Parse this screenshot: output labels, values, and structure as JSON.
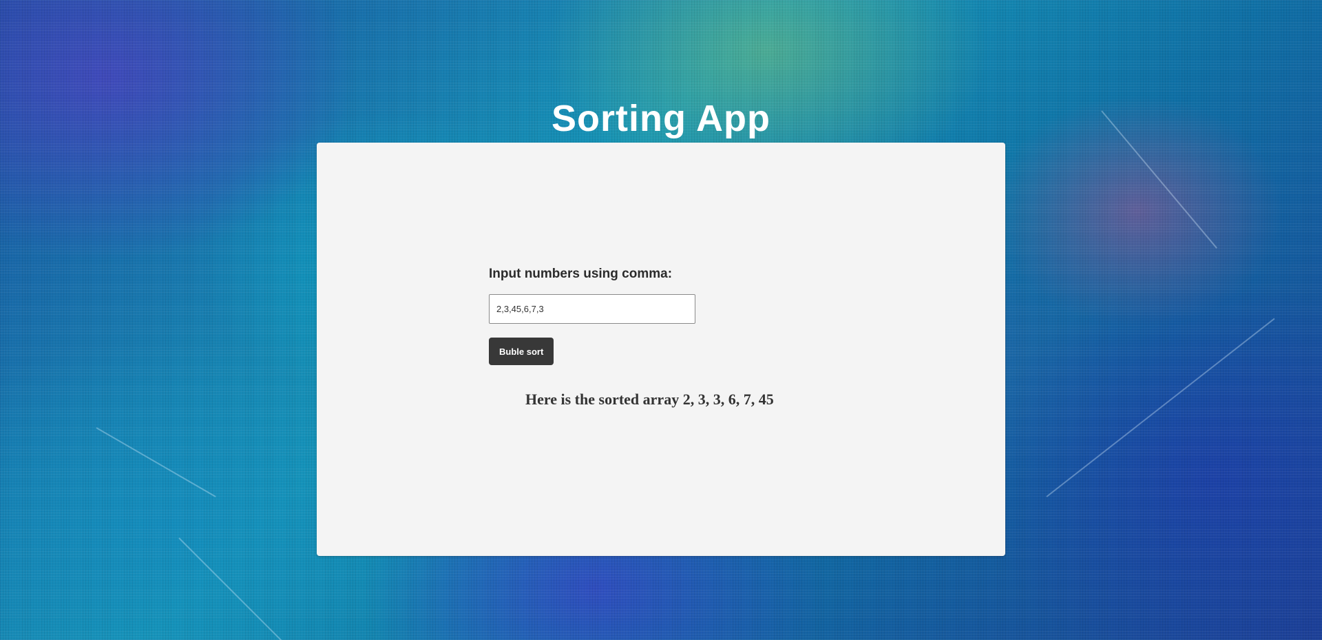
{
  "app": {
    "title": "Sorting App"
  },
  "form": {
    "label": "Input numbers using comma:",
    "input_value": "2,3,45,6,7,3",
    "button_label": "Buble sort"
  },
  "result": {
    "text": "Here is the sorted array 2, 3, 3, 6, 7, 45"
  },
  "colors": {
    "card_background": "#f4f4f4",
    "button_background": "#383838",
    "title_color": "#ffffff"
  }
}
